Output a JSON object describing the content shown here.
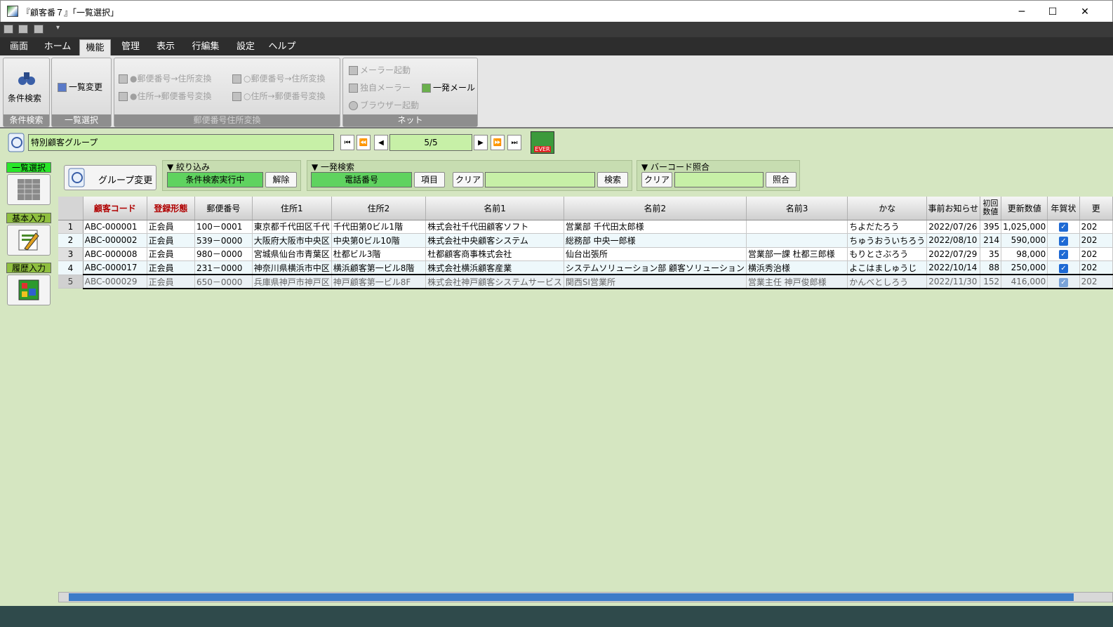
{
  "window": {
    "title": "『顧客番７』「一覧選択」",
    "minimize": "─",
    "maximize": "☐",
    "close": "✕"
  },
  "menu": [
    "画面",
    "ホーム",
    "機能",
    "管理",
    "表示",
    "行編集",
    "設定",
    "ヘルプ"
  ],
  "ribbon": {
    "g1": {
      "button": "条件検索",
      "label": "条件検索"
    },
    "g2": {
      "button": "一覧変更",
      "label": "一覧選択"
    },
    "g3": {
      "b1": "●郵便番号→住所変換",
      "b2": "●住所→郵便番号変換",
      "b3": "○郵便番号→住所変換",
      "b4": "○住所→郵便番号変換",
      "label": "郵便番号住所変換"
    },
    "g4": {
      "b1": "メーラー起動",
      "b2": "独自メーラー",
      "b3": "ブラウザー起動",
      "b4": "一発メール",
      "label": "ネット"
    }
  },
  "group": {
    "name": "特別顧客グループ",
    "position": "5/5",
    "ever_label": "EVER"
  },
  "side": {
    "list": "一覧選択",
    "basic": "基本入力",
    "history": "履歴入力"
  },
  "panels": {
    "group_change": "グループ変更",
    "filter": {
      "title": "▼ 絞り込み",
      "status": "条件検索実行中",
      "release": "解除"
    },
    "search": {
      "title": "▼ 一発検索",
      "field": "電話番号",
      "item": "項目",
      "clear": "クリア",
      "value": "",
      "go": "検索"
    },
    "barcode": {
      "title": "▼ バーコード照合",
      "clear": "クリア",
      "value": "",
      "check": "照合"
    }
  },
  "table": {
    "headers": [
      "顧客コード",
      "登録形態",
      "郵便番号",
      "住所1",
      "住所2",
      "名前1",
      "名前2",
      "名前3",
      "かな",
      "事前お知らせ",
      "初回数値",
      "更新数値",
      "年賀状",
      "更"
    ],
    "rows": [
      {
        "n": "1",
        "code": "ABC-000001",
        "type": "正会員",
        "zip": "100－0001",
        "addr1": "東京都千代田区千代",
        "addr2": "千代田第0ビル1階",
        "name1": "株式会社千代田顧客ソフト",
        "name2": "営業部 千代田太郎様",
        "name3": "",
        "kana": "ちよだたろう",
        "notice": "2022/07/26",
        "first": "395",
        "update": "1,025,000",
        "nenga": "✓",
        "last": "202"
      },
      {
        "n": "2",
        "code": "ABC-000002",
        "type": "正会員",
        "zip": "539－0000",
        "addr1": "大阪府大阪市中央区",
        "addr2": "中央第0ビル10階",
        "name1": "株式会社中央顧客システム",
        "name2": "総務部 中央一郎様",
        "name3": "",
        "kana": "ちゅうおういちろう",
        "notice": "2022/08/10",
        "first": "214",
        "update": "590,000",
        "nenga": "✓",
        "last": "202"
      },
      {
        "n": "3",
        "code": "ABC-000008",
        "type": "正会員",
        "zip": "980－0000",
        "addr1": "宮城県仙台市青葉区",
        "addr2": "杜都ビル3階",
        "name1": "杜都顧客商事株式会社",
        "name2": "仙台出張所",
        "name3": "営業部一課 杜都三郎様",
        "kana": "もりとさぶろう",
        "notice": "2022/07/29",
        "first": "35",
        "update": "98,000",
        "nenga": "✓",
        "last": "202"
      },
      {
        "n": "4",
        "code": "ABC-000017",
        "type": "正会員",
        "zip": "231－0000",
        "addr1": "神奈川県横浜市中区",
        "addr2": "横浜顧客第一ビル8階",
        "name1": "株式会社横浜顧客産業",
        "name2": "システムソリューション部 顧客ソリューション",
        "name3": "横浜秀治様",
        "kana": "よこはましゅうじ",
        "notice": "2022/10/14",
        "first": "88",
        "update": "250,000",
        "nenga": "✓",
        "last": "202"
      },
      {
        "n": "5",
        "code": "ABC-000029",
        "type": "正会員",
        "zip": "650－0000",
        "addr1": "兵庫県神戸市神戸区",
        "addr2": "神戸顧客第一ビル8F",
        "name1": "株式会社神戸顧客システムサービス",
        "name2": "関西SI営業所",
        "name3": "営業主任 神戸俊郎様",
        "kana": "かんべとしろう",
        "notice": "2022/11/30",
        "first": "152",
        "update": "416,000",
        "nenga": "✓",
        "last": "202"
      }
    ]
  }
}
